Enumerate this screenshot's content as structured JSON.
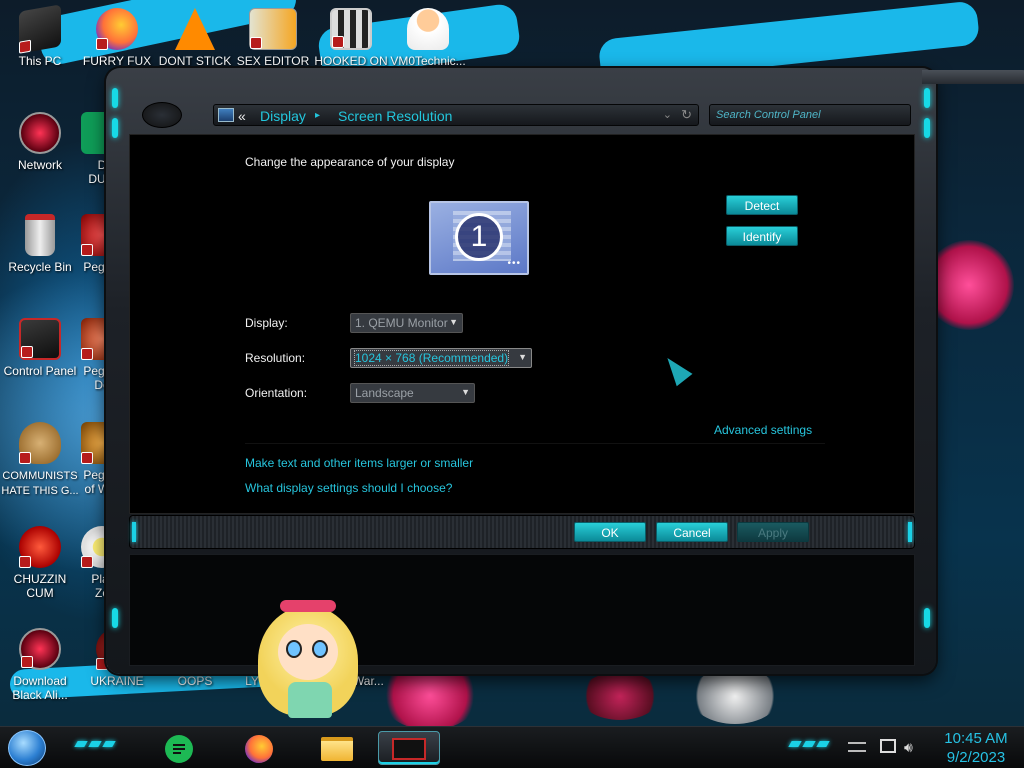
{
  "desktop": {
    "icons": [
      {
        "id": "this-pc",
        "label": "This PC"
      },
      {
        "id": "furry-fux",
        "label": "FURRY FUX"
      },
      {
        "id": "dont-stick",
        "label": "DONT STICK"
      },
      {
        "id": "sex-editor",
        "label": "SEX EDITOR"
      },
      {
        "id": "hooked-on",
        "label": "HOOKED ON"
      },
      {
        "id": "vm0technic",
        "label": "VM0Technic..."
      },
      {
        "id": "network",
        "label": "Network"
      },
      {
        "id": "d-dum",
        "label": "D\nDUM"
      },
      {
        "id": "recycle-bin",
        "label": "Recycle Bin"
      },
      {
        "id": "peggle-1",
        "label": "Peggle"
      },
      {
        "id": "control-panel",
        "label": "Control Panel"
      },
      {
        "id": "peggle-de",
        "label": "Peggle\nDe"
      },
      {
        "id": "communists",
        "label": "COMMUNISTS\nHATE THIS G..."
      },
      {
        "id": "peggle-of-war",
        "label": "Peggle\nof War"
      },
      {
        "id": "chuzzin-cum",
        "label": "CHUZZIN\nCUM"
      },
      {
        "id": "plants-zombies",
        "label": "Plar\nZo"
      },
      {
        "id": "download-black-ali",
        "label": "Download\nBlack Ali..."
      },
      {
        "id": "ukraine",
        "label": "UKRAINE"
      },
      {
        "id": "oops",
        "label": "OOPS"
      },
      {
        "id": "ly",
        "label": "LY"
      },
      {
        "id": "comwar",
        "label": "omWar..."
      }
    ]
  },
  "window": {
    "breadcrumb": {
      "back_glyph": "«",
      "display": "Display",
      "separator": "▸",
      "screen_resolution": "Screen Resolution"
    },
    "search_placeholder": "Search Control Panel",
    "heading": "Change the appearance of your display",
    "monitor_number": "1",
    "detect_label": "Detect",
    "identify_label": "Identify",
    "display_label": "Display:",
    "display_value": "1. QEMU Monitor",
    "resolution_label": "Resolution:",
    "resolution_value": "1024 × 768 (Recommended)",
    "orientation_label": "Orientation:",
    "orientation_value": "Landscape",
    "advanced_link": "Advanced settings",
    "link_text_size": "Make text and other items larger or smaller",
    "link_which_settings": "What display settings should I choose?",
    "ok_label": "OK",
    "cancel_label": "Cancel",
    "apply_label": "Apply"
  },
  "taskbar": {
    "time": "10:45 AM",
    "date": "9/2/2023",
    "pinned": [
      "notes-icon",
      "firefox-icon",
      "file-explorer-icon",
      "control-panel-task-icon"
    ]
  },
  "colors": {
    "accent": "#23c6dc",
    "button": "#1fb4c2"
  }
}
